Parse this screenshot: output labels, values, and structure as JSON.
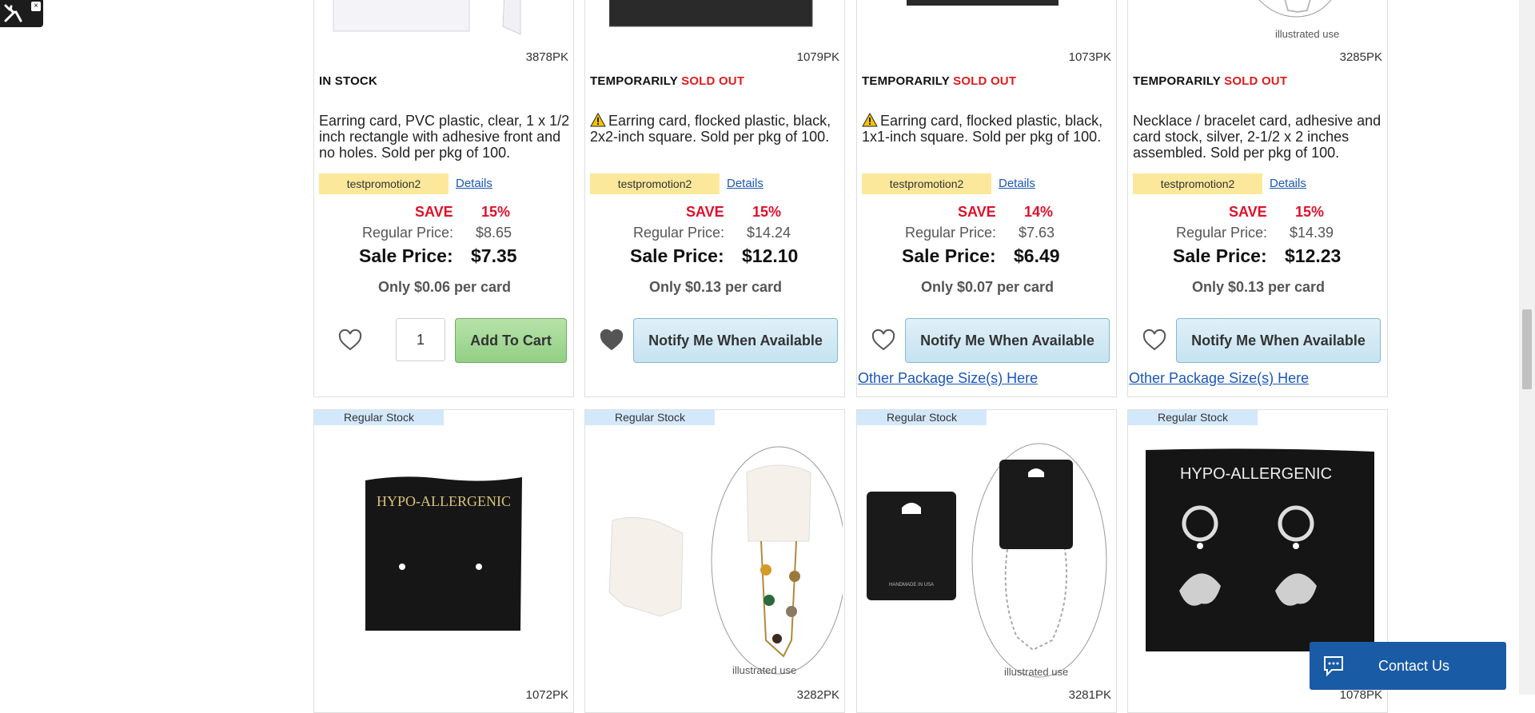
{
  "tool_widget": {
    "close": "×"
  },
  "products_row1": [
    {
      "sku": "3878PK",
      "stock_prefix": "IN STOCK",
      "stock_sold": "",
      "warning": false,
      "description": "Earring card, PVC plastic, clear, 1 x 1/2 inch rectangle with adhesive front and no holes. Sold per pkg of 100.",
      "promo": "testpromotion2",
      "details": "Details",
      "save_label": "SAVE",
      "save_pct": "15%",
      "regular_label": "Regular Price:",
      "regular_price": "$8.65",
      "sale_label": "Sale Price:",
      "sale_price": "$7.35",
      "per_unit": "Only $0.06 per card",
      "qty": "1",
      "button": "Add To Cart",
      "other": ""
    },
    {
      "sku": "1079PK",
      "stock_prefix": "TEMPORARILY",
      "stock_sold": "SOLD OUT",
      "warning": true,
      "description": "Earring card, flocked plastic, black, 2x2-inch square. Sold per pkg of 100.",
      "promo": "testpromotion2",
      "details": "Details",
      "save_label": "SAVE",
      "save_pct": "15%",
      "regular_label": "Regular Price:",
      "regular_price": "$14.24",
      "sale_label": "Sale Price:",
      "sale_price": "$12.10",
      "per_unit": "Only $0.13 per card",
      "button": "Notify Me When Available",
      "other": ""
    },
    {
      "sku": "1073PK",
      "stock_prefix": "TEMPORARILY",
      "stock_sold": "SOLD OUT",
      "warning": true,
      "description": "Earring card, flocked plastic, black, 1x1-inch square. Sold per pkg of 100.",
      "promo": "testpromotion2",
      "details": "Details",
      "save_label": "SAVE",
      "save_pct": "14%",
      "regular_label": "Regular Price:",
      "regular_price": "$7.63",
      "sale_label": "Sale Price:",
      "sale_price": "$6.49",
      "per_unit": "Only $0.07 per card",
      "button": "Notify Me When Available",
      "other": "Other Package Size(s) Here"
    },
    {
      "sku": "3285PK",
      "stock_prefix": "TEMPORARILY",
      "stock_sold": "SOLD OUT",
      "warning": false,
      "illustrated": "illustrated use",
      "description": "Necklace / bracelet card, adhesive and card stock, silver, 2-1/2 x 2 inches assembled. Sold per pkg of 100.",
      "promo": "testpromotion2",
      "details": "Details",
      "save_label": "SAVE",
      "save_pct": "15%",
      "regular_label": "Regular Price:",
      "regular_price": "$14.39",
      "sale_label": "Sale Price:",
      "sale_price": "$12.23",
      "per_unit": "Only $0.13 per card",
      "button": "Notify Me When Available",
      "other": "Other Package Size(s) Here"
    }
  ],
  "products_row2": [
    {
      "badge": "Regular Stock",
      "sku": "1072PK",
      "card_text": "HYPO-ALLERGENIC"
    },
    {
      "badge": "Regular Stock",
      "sku": "3282PK",
      "illustrated": "illustrated use"
    },
    {
      "badge": "Regular Stock",
      "sku": "3281PK",
      "illustrated": "illustrated use",
      "card_text_small": "HANDMADE IN USA"
    },
    {
      "badge": "Regular Stock",
      "sku": "1078PK",
      "card_text": "HYPO-ALLERGENIC"
    }
  ],
  "contact": {
    "label": "Contact Us"
  },
  "colors": {
    "sold_out": "#e01d1d",
    "save": "#e0102a",
    "promo_bg": "#fbe89a",
    "link": "#1a57b8",
    "badge_bg": "#d4e8fb",
    "contact_bg": "#1a5ba6"
  }
}
